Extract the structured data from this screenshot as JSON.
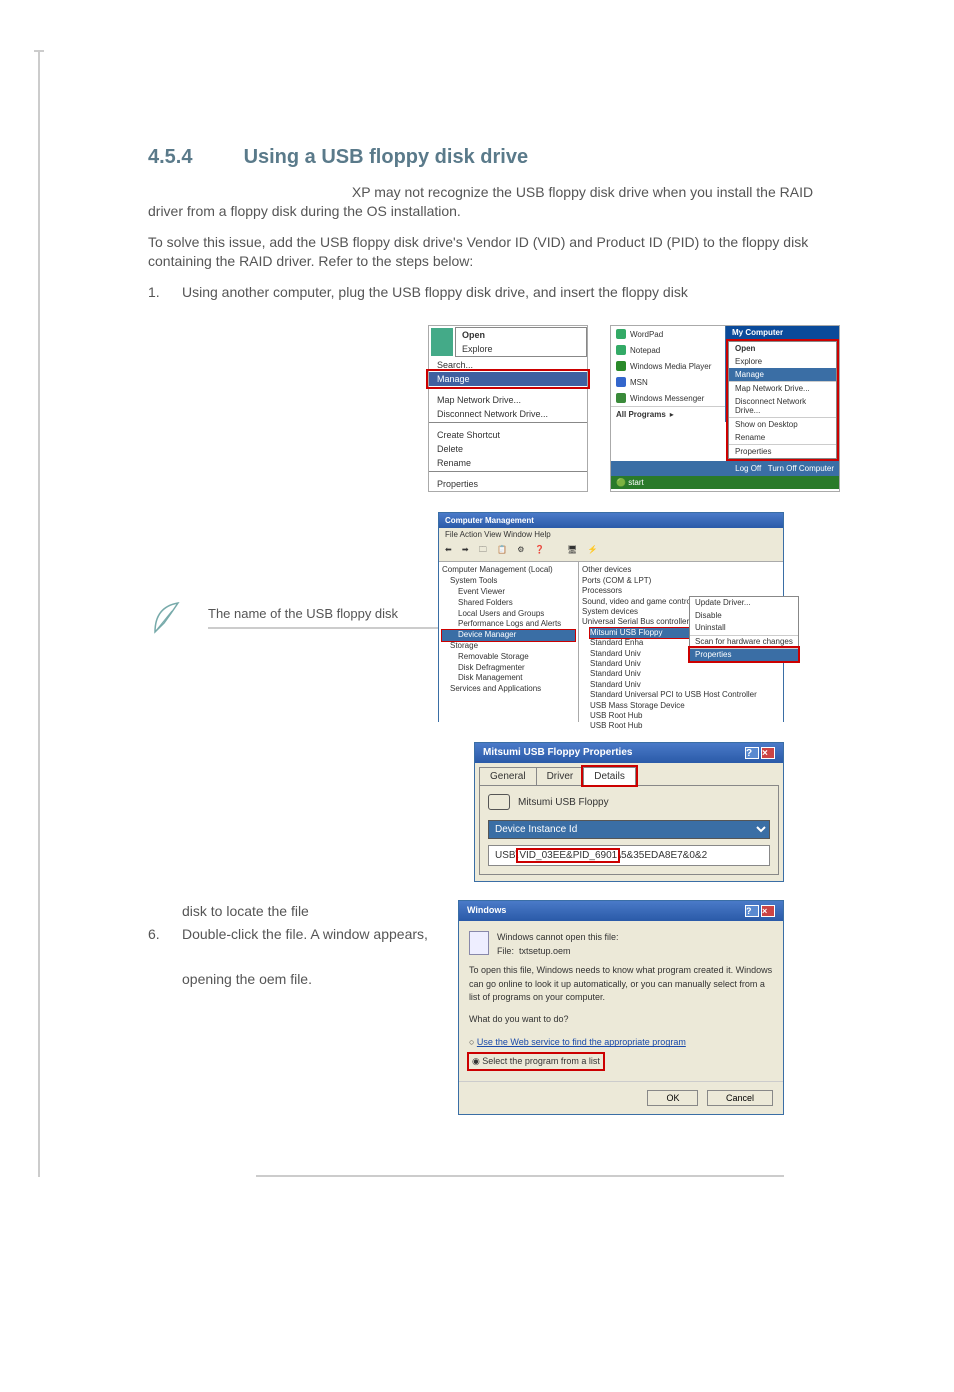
{
  "section": {
    "number": "4.5.4",
    "title": "Using a USB floppy disk drive"
  },
  "para1_a": "XP may not recognize the USB floppy disk drive when you",
  "para1_b": "install the RAID driver from a floppy disk during the OS installation.",
  "para2": "To solve this issue, add the USB floppy disk drive's Vendor ID (VID) and Product ID (PID) to the floppy disk containing the RAID driver. Refer to the steps below:",
  "step1_n": "1.",
  "step1": "Using another computer, plug the USB floppy disk drive, and insert the floppy disk",
  "ctx": {
    "open": "Open",
    "explore": "Explore",
    "search": "Search...",
    "manage": "Manage",
    "map": "Map Network Drive...",
    "disconnect": "Disconnect Network Drive...",
    "shortcut": "Create Shortcut",
    "delete": "Delete",
    "rename": "Rename",
    "properties": "Properties"
  },
  "startmenu": {
    "wordpad": "WordPad",
    "notepad": "Notepad",
    "wmp": "Windows Media Player",
    "msn": "MSN",
    "messenger": "Windows Messenger",
    "allprograms": "All Programs",
    "mycomputer": "My Computer",
    "open": "Open",
    "explore": "Explore",
    "manage": "Manage",
    "mapnet": "Map Network Drive...",
    "disc": "Disconnect Network Drive...",
    "showdesk": "Show on Desktop",
    "rename": "Rename",
    "properties": "Properties",
    "logoff": "Log Off",
    "turnoff": "Turn Off Computer",
    "start": "start"
  },
  "note": "The name of the USB floppy disk",
  "mgmt": {
    "title": "Computer Management",
    "menu": "File   Action   View   Window   Help",
    "tree": {
      "root": "Computer Management (Local)",
      "systools": "System Tools",
      "event": "Event Viewer",
      "shared": "Shared Folders",
      "users": "Local Users and Groups",
      "perf": "Performance Logs and Alerts",
      "devmgr": "Device Manager",
      "storage": "Storage",
      "removable": "Removable Storage",
      "defrag": "Disk Defragmenter",
      "diskmgmt": "Disk Management",
      "services": "Services and Applications"
    },
    "right": {
      "other": "Other devices",
      "ports": "Ports (COM & LPT)",
      "processors": "Processors",
      "sound": "Sound, video and game controllers",
      "system": "System devices",
      "usb": "Universal Serial Bus controllers",
      "mitsumi": "Mitsumi USB Floppy",
      "std1": "Standard Enha",
      "std2": "Standard Univ",
      "std3": "Standard Univ",
      "std4": "Standard Univ",
      "std5": "Standard Univ",
      "stdfull": "Standard Universal PCI to USB Host Controller",
      "mass": "USB Mass Storage Device",
      "root1": "USB Root Hub",
      "root2": "USB Root Hub"
    },
    "ctx": {
      "update": "Update Driver...",
      "disable": "Disable",
      "uninstall": "Uninstall",
      "scan": "Scan for hardware changes",
      "properties": "Properties"
    }
  },
  "props": {
    "title": "Mitsumi USB Floppy Properties",
    "tabs": {
      "general": "General",
      "driver": "Driver",
      "details": "Details"
    },
    "devname": "Mitsumi USB Floppy",
    "dropdown": "Device Instance Id",
    "id_pre": "USB\\",
    "id_mark": "VID_03EE&PID_6901",
    "id_post": "\\5&35EDA8E7&0&2"
  },
  "step5_tail": "disk to locate the file",
  "step6_n": "6.",
  "step6_a": "Double-click the file. A window appears,",
  "step6_b": "opening the oem file.",
  "dlg": {
    "title": "Windows",
    "cannot": "Windows cannot open this file:",
    "file_lbl": "File:",
    "file": "txtsetup.oem",
    "msg": "To open this file, Windows needs to know what program created it. Windows can go online to look it up automatically, or you can manually select from a list of programs on your computer.",
    "q": "What do you want to do?",
    "opt1": "Use the Web service to find the appropriate program",
    "opt2": "Select the program from a list",
    "ok": "OK",
    "cancel": "Cancel"
  }
}
